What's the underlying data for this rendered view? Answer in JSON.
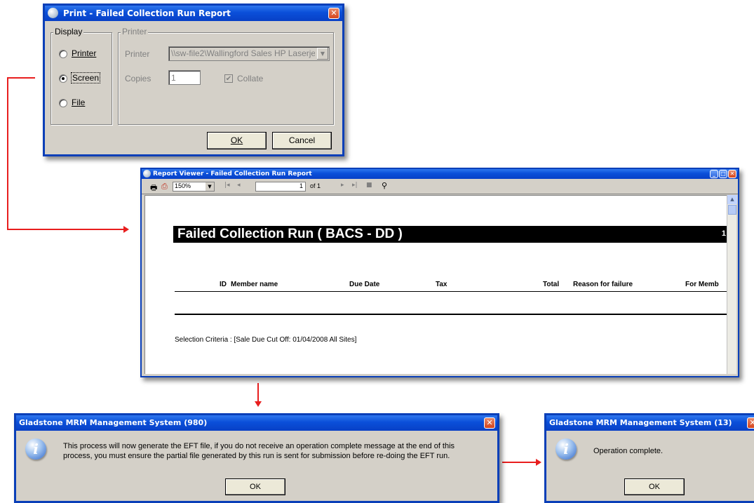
{
  "print_dialog": {
    "title": "Print - Failed Collection Run Report",
    "display_group": "Display",
    "printer_group": "Printer",
    "options": {
      "printer": "Printer",
      "screen": "Screen",
      "file": "File"
    },
    "selected": "Screen",
    "printer_label": "Printer",
    "printer_value": "\\\\sw-file2\\Wallingford Sales HP Laserje",
    "copies_label": "Copies",
    "copies_value": "1",
    "collate_label": "Collate",
    "ok_label": "OK",
    "cancel_label": "Cancel"
  },
  "report_viewer": {
    "title": "Report Viewer - Failed Collection Run Report",
    "zoom": "150%",
    "page": "1",
    "page_of": "of 1",
    "report_title": "Failed Collection Run ( BACS - DD )",
    "page_number_fragment": "1",
    "columns": [
      "ID",
      "Member name",
      "Due Date",
      "Tax",
      "Total",
      "Reason for failure",
      "For Memb"
    ],
    "selection_criteria": "Selection Criteria : [Sale Due Cut Off: 01/04/2008 All Sites]"
  },
  "msg_dialog_1": {
    "title": "Gladstone MRM Management System (980)",
    "line1": "This process will now generate the EFT file, if you do not receive an operation complete message at the end of this",
    "line2": "process, you must ensure the partial file generated by this run is sent for submission before re-doing the EFT run.",
    "ok_label": "OK",
    "icon": "information-icon"
  },
  "msg_dialog_2": {
    "title": "Gladstone MRM Management System (13)",
    "message": "Operation complete.",
    "ok_label": "OK",
    "icon": "information-icon"
  },
  "colors": {
    "titlebar": "#0a4fd9",
    "arrow": "#e81e1e",
    "dialog_bg": "#d4d0c8"
  }
}
